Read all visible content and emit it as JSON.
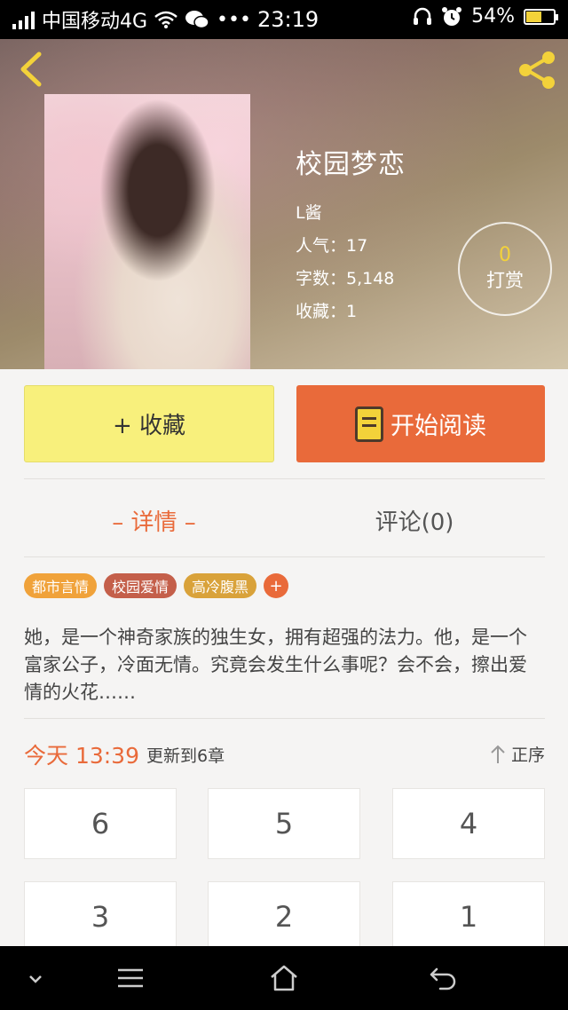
{
  "status_bar": {
    "carrier": "中国移动4G",
    "time": "23:19",
    "battery": "54%",
    "icons": [
      "signal-icon",
      "wifi-icon",
      "wechat-icon",
      "more-icon",
      "headset-icon",
      "alarm-icon",
      "battery-icon"
    ]
  },
  "book": {
    "title": "校园梦恋",
    "author": "L酱",
    "popularity": "人气：17",
    "word_count": "字数：5,148",
    "favorites": "收藏：1"
  },
  "reward": {
    "count": "0",
    "label": "打赏"
  },
  "actions": {
    "collect": "+ 收藏",
    "read": "开始阅读"
  },
  "tabs": {
    "detail": "– 详情 –",
    "comments": "评论(0)"
  },
  "tags": [
    {
      "label": "都市言情",
      "color": "#f0a23a"
    },
    {
      "label": "校园爱情",
      "color": "#c45f4a"
    },
    {
      "label": "高冷腹黑",
      "color": "#d9a23a"
    }
  ],
  "tag_add": "+",
  "description": "她，是一个神奇家族的独生女，拥有超强的法力。他，是一个富家公子，冷面无情。究竟会发生什么事呢？会不会，擦出爱情的火花……",
  "update": {
    "time": "今天 13:39",
    "text": "更新到6章",
    "sort_label": "正序"
  },
  "chapters": [
    "6",
    "5",
    "4",
    "3",
    "2",
    "1"
  ],
  "colors": {
    "accent": "#e96a3a",
    "collect_bg": "#f8f07c",
    "highlight": "#f3d23a"
  }
}
